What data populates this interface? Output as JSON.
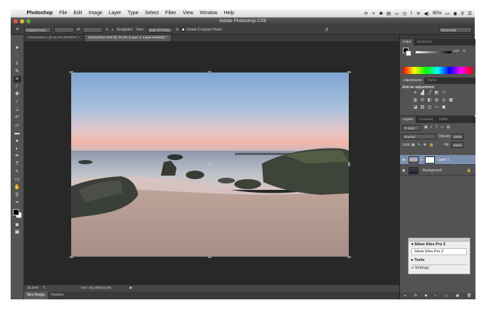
{
  "menubar": {
    "app_name": "Photoshop",
    "menus": [
      "File",
      "Edit",
      "Image",
      "Layer",
      "Type",
      "Select",
      "Filter",
      "View",
      "Window",
      "Help"
    ],
    "battery": "95%"
  },
  "window": {
    "title": "Adobe Photoshop CS6"
  },
  "options": {
    "ratio": "Original Ratio",
    "straighten": "Straighten",
    "view_label": "View:",
    "view_value": "Rule of Thirds",
    "delete_cropped": "Delete Cropped Pixels",
    "workspace": "Essentials"
  },
  "tabs": [
    {
      "label": "DS3U5324-2 @ 33,3% (RGB/8*) ×"
    },
    {
      "label": "DS3U5324.CR2 @ 33,3% (Layer 1, Layer Mask/8) *"
    }
  ],
  "status": {
    "zoom": "33,33%",
    "doc": "Doc: 53,3M/102,5M"
  },
  "bottom_tabs": [
    "Mini Bridge",
    "Timeline"
  ],
  "panels": {
    "color_tabs": [
      "Color",
      "Swatches"
    ],
    "color_value": "100",
    "color_unit": "%",
    "adj_tabs": [
      "Adjustments",
      "Styles"
    ],
    "adj_title": "Add an adjustment",
    "layers_tabs": [
      "Layers",
      "Channels",
      "Paths"
    ],
    "kind": "Kind",
    "blend_mode": "Normal",
    "opacity_label": "Opacity:",
    "opacity": "100%",
    "lock_label": "Lock:",
    "fill_label": "Fill:",
    "fill": "100%",
    "layers": [
      {
        "name": "Layer 1"
      },
      {
        "name": "Background"
      }
    ]
  },
  "efex": {
    "title": "Silver Efex Pro 2",
    "preset": "Silver Efex Pro 2",
    "tools": "Tools",
    "settings": "Settings"
  },
  "colors": {
    "ui_dark": "#282828",
    "panel": "#535353",
    "selected_layer": "#7b8fae"
  }
}
